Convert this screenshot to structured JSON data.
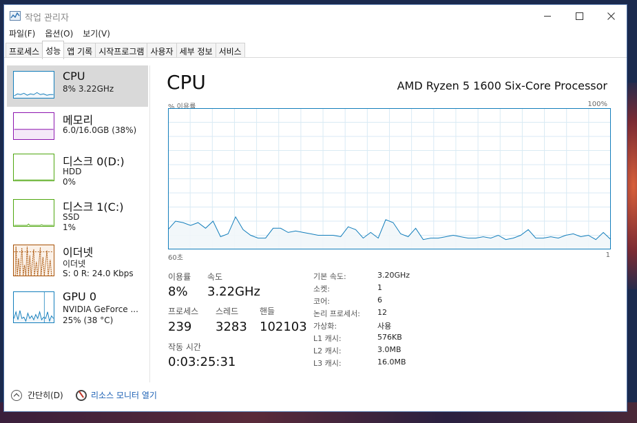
{
  "window": {
    "title": "작업 관리자"
  },
  "menu": [
    "파일(F)",
    "옵션(O)",
    "보기(V)"
  ],
  "tabs": [
    "프로세스",
    "성능",
    "앱 기록",
    "시작프로그램",
    "사용자",
    "세부 정보",
    "서비스"
  ],
  "active_tab": "성능",
  "sidebar": [
    {
      "title": "CPU",
      "lines": [
        "8% 3.22GHz"
      ],
      "color": "#117dbb",
      "selected": true
    },
    {
      "title": "메모리",
      "lines": [
        "6.0/16.0GB (38%)"
      ],
      "color": "#8b12ae"
    },
    {
      "title": "디스크 0(D:)",
      "lines": [
        "HDD",
        "0%"
      ],
      "color": "#4da60c"
    },
    {
      "title": "디스크 1(C:)",
      "lines": [
        "SSD",
        "1%"
      ],
      "color": "#4da60c"
    },
    {
      "title": "이더넷",
      "lines": [
        "이더넷",
        "S: 0  R: 24.0 Kbps"
      ],
      "color": "#a74f01"
    },
    {
      "title": "GPU 0",
      "lines": [
        "NVIDIA GeForce ...",
        "25% (38 °C)"
      ],
      "color": "#117dbb"
    }
  ],
  "main": {
    "title": "CPU",
    "cpu_name": "AMD Ryzen 5 1600 Six-Core Processor",
    "axis_top_left": "% 이용률",
    "axis_top_right": "100%",
    "axis_bottom_left": "60초",
    "axis_bottom_right": "1",
    "stats": {
      "util_label": "이용률",
      "util": "8%",
      "speed_label": "속도",
      "speed": "3.22GHz",
      "proc_label": "프로세스",
      "proc": "239",
      "thread_label": "스레드",
      "thread": "3283",
      "handle_label": "핸들",
      "handle": "102103",
      "uptime_label": "작동 시간",
      "uptime": "0:03:25:31"
    },
    "info": [
      {
        "label": "기본 속도:",
        "value": "3.20GHz"
      },
      {
        "label": "소켓:",
        "value": "1"
      },
      {
        "label": "코어:",
        "value": "6"
      },
      {
        "label": "논리 프로세서:",
        "value": "12"
      },
      {
        "label": "가상화:",
        "value": "사용"
      },
      {
        "label": "L1 캐시:",
        "value": "576KB"
      },
      {
        "label": "L2 캐시:",
        "value": "3.0MB"
      },
      {
        "label": "L3 캐시:",
        "value": "16.0MB"
      }
    ]
  },
  "chart_data": {
    "type": "area",
    "ylim": [
      0,
      100
    ],
    "color": "#117dbb",
    "values": [
      14,
      20,
      19,
      17,
      19,
      15,
      20,
      9,
      11,
      23,
      14,
      10,
      8,
      8,
      15,
      15,
      12,
      13,
      12,
      11,
      10,
      10,
      10,
      9,
      16,
      14,
      8,
      12,
      8,
      21,
      19,
      11,
      9,
      15,
      7,
      8,
      8,
      9,
      10,
      9,
      8,
      8,
      9,
      8,
      10,
      7,
      8,
      10,
      14,
      8,
      8,
      9,
      8,
      10,
      11,
      9,
      10,
      7,
      12,
      7
    ]
  },
  "bottom": {
    "fewer_details": "간단히(D)",
    "resource_monitor": "리소스 모니터 열기"
  }
}
